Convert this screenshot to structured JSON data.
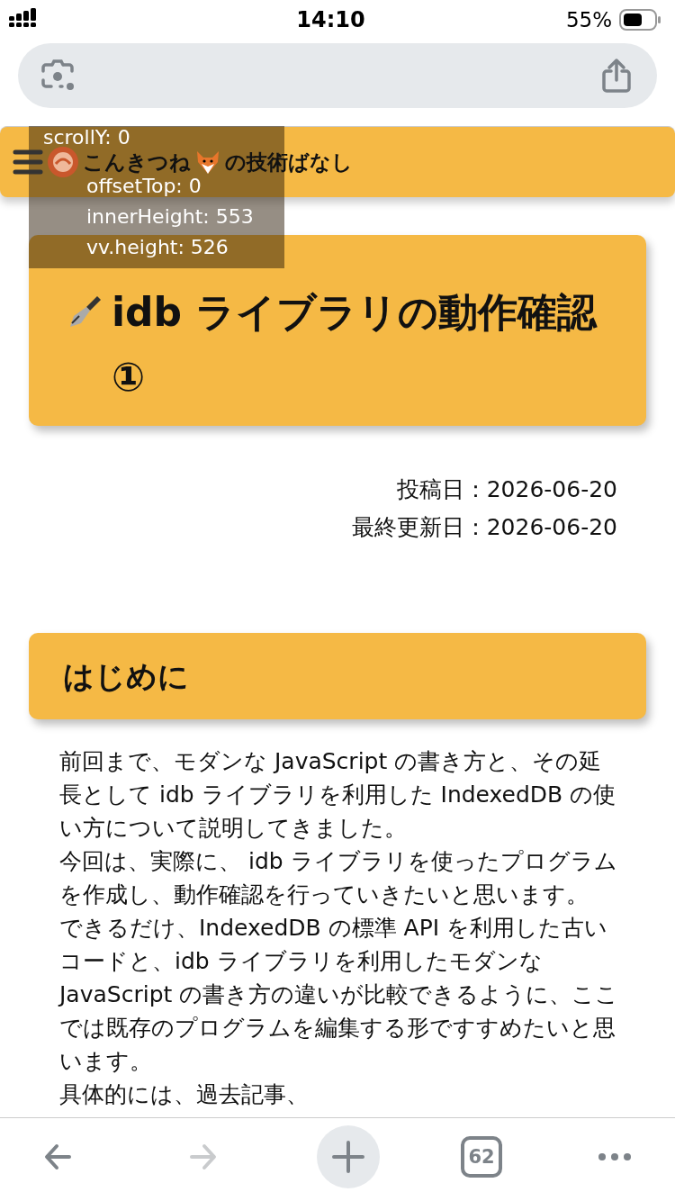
{
  "status_bar": {
    "time": "14:10",
    "battery": "55%"
  },
  "browser": {
    "toolbar": [
      {
        "kind": "back",
        "disabled": false
      },
      {
        "kind": "forward",
        "disabled": true
      },
      {
        "kind": "new-tab",
        "disabled": false
      },
      {
        "kind": "tabs",
        "disabled": false,
        "count": "62"
      },
      {
        "kind": "more",
        "disabled": false
      }
    ]
  },
  "site_header": {
    "title_before": "こんきつね",
    "title_after": "の技術ばなし"
  },
  "debug_overlay": {
    "lines": [
      "scrollY: 0",
      "offsetTop: 0",
      "innerHeight: 553",
      "vv.height: 526"
    ]
  },
  "article": {
    "title": "idb ライブラリの動作確認①",
    "dates": [
      "投稿日：2026-06-20",
      "最終更新日：2026-06-20"
    ],
    "section_heading": "はじめに",
    "paragraphs": [
      "前回まで、モダンな JavaScript の書き方と、その延長として idb ライブラリを利用した IndexedDB の使い方について説明してきました。",
      "今回は、実際に、 idb ライブラリを使ったプログラムを作成し、動作確認を行っていきたいと思います。",
      "できるだけ、IndexedDB の標準 API を利用した古いコードと、idb ライブラリを利用したモダンな JavaScript の書き方の違いが比較できるように、ここでは既存のプログラムを編集する形ですすめたいと思います。",
      "具体的には、過去記事、"
    ]
  }
}
